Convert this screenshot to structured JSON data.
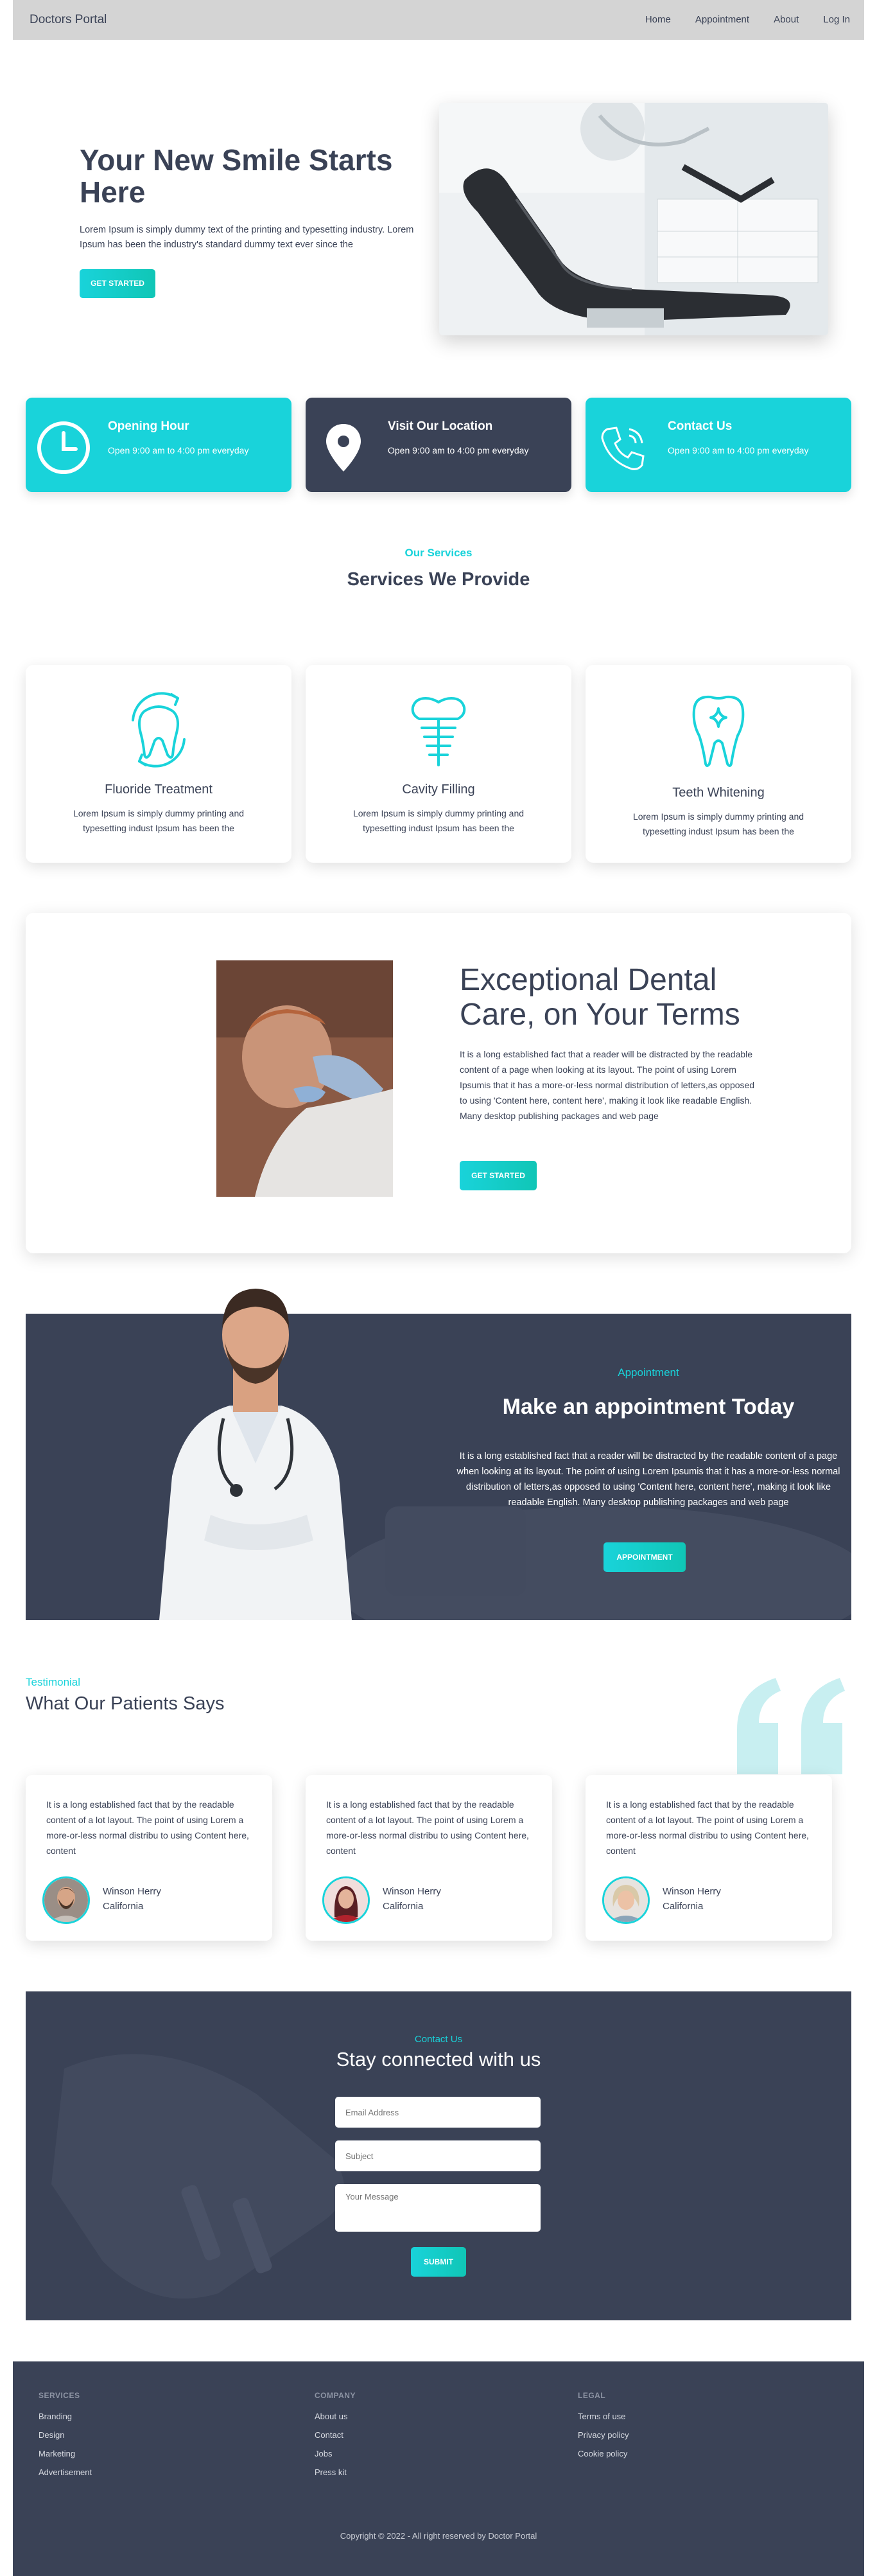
{
  "nav": {
    "brand": "Doctors Portal",
    "links": [
      "Home",
      "Appointment",
      "About",
      "Log In"
    ]
  },
  "hero": {
    "title": "Your New Smile Starts Here",
    "text": "Lorem Ipsum is simply dummy text of the printing and typesetting industry. Lorem Ipsum has been the industry's standard dummy text ever since the",
    "button": "GET STARTED"
  },
  "info": [
    {
      "title": "Opening Hour",
      "text": "Open 9:00 am to 4:00 pm everyday",
      "icon": "clock-icon"
    },
    {
      "title": "Visit Our Location",
      "text": "Open 9:00 am to 4:00 pm everyday",
      "icon": "map-pin-icon"
    },
    {
      "title": "Contact Us",
      "text": "Open 9:00 am to 4:00 pm everyday",
      "icon": "phone-icon"
    }
  ],
  "services": {
    "label": "Our Services",
    "title": "Services We Provide",
    "items": [
      {
        "title": "Fluoride Treatment",
        "text": "Lorem Ipsum is simply dummy printing and typesetting indust Ipsum has been the",
        "icon": "fluoride-tooth-icon"
      },
      {
        "title": "Cavity Filling",
        "text": "Lorem Ipsum is simply dummy printing and typesetting indust Ipsum has been the",
        "icon": "dental-implant-icon"
      },
      {
        "title": "Teeth Whitening",
        "text": "Lorem Ipsum is simply dummy printing and typesetting indust Ipsum has been the",
        "icon": "sparkle-tooth-icon"
      }
    ]
  },
  "exceptional": {
    "title": "Exceptional Dental Care, on Your Terms",
    "text": "It is a long established fact that a reader will be distracted by the readable content of a page when looking at its layout. The point of using Lorem Ipsumis that it has a more-or-less normal distribution of letters,as opposed to using 'Content here, content here', making it look like readable English. Many desktop publishing packages and web page",
    "button": "GET STARTED"
  },
  "appointment": {
    "label": "Appointment",
    "title": "Make an appointment Today",
    "text": "It is a long established fact that a reader will be distracted by the readable content of a page when looking at its layout. The point of using Lorem Ipsumis that it has a more-or-less normal distribution of letters,as opposed to using 'Content here, content here', making it look like readable English. Many desktop publishing packages and web page",
    "button": "APPOINTMENT"
  },
  "testimonial": {
    "label": "Testimonial",
    "title": "What Our Patients Says",
    "items": [
      {
        "text": "It is a long established fact that by the readable content of a lot layout. The point of using Lorem a more-or-less normal distribu to using Content here, content",
        "name": "Winson Herry",
        "location": "California"
      },
      {
        "text": "It is a long established fact that by the readable content of a lot layout. The point of using Lorem a more-or-less normal distribu to using Content here, content",
        "name": "Winson Herry",
        "location": "California"
      },
      {
        "text": "It is a long established fact that by the readable content of a lot layout. The point of using Lorem a more-or-less normal distribu to using Content here, content",
        "name": "Winson Herry",
        "location": "California"
      }
    ]
  },
  "contact": {
    "label": "Contact Us",
    "title": "Stay connected with us",
    "email_placeholder": "Email Address",
    "subject_placeholder": "Subject",
    "message_placeholder": "Your Message",
    "button": "SUBMIT"
  },
  "footer": {
    "columns": [
      {
        "title": "SERVICES",
        "links": [
          "Branding",
          "Design",
          "Marketing",
          "Advertisement"
        ]
      },
      {
        "title": "COMPANY",
        "links": [
          "About us",
          "Contact",
          "Jobs",
          "Press kit"
        ]
      },
      {
        "title": "LEGAL",
        "links": [
          "Terms of use",
          "Privacy policy",
          "Cookie policy"
        ]
      }
    ],
    "copyright": "Copyright © 2022 - All right reserved by Doctor Portal"
  },
  "colors": {
    "accent": "#19d3da",
    "dark": "#3a4256",
    "nav": "#d4d4d4"
  }
}
